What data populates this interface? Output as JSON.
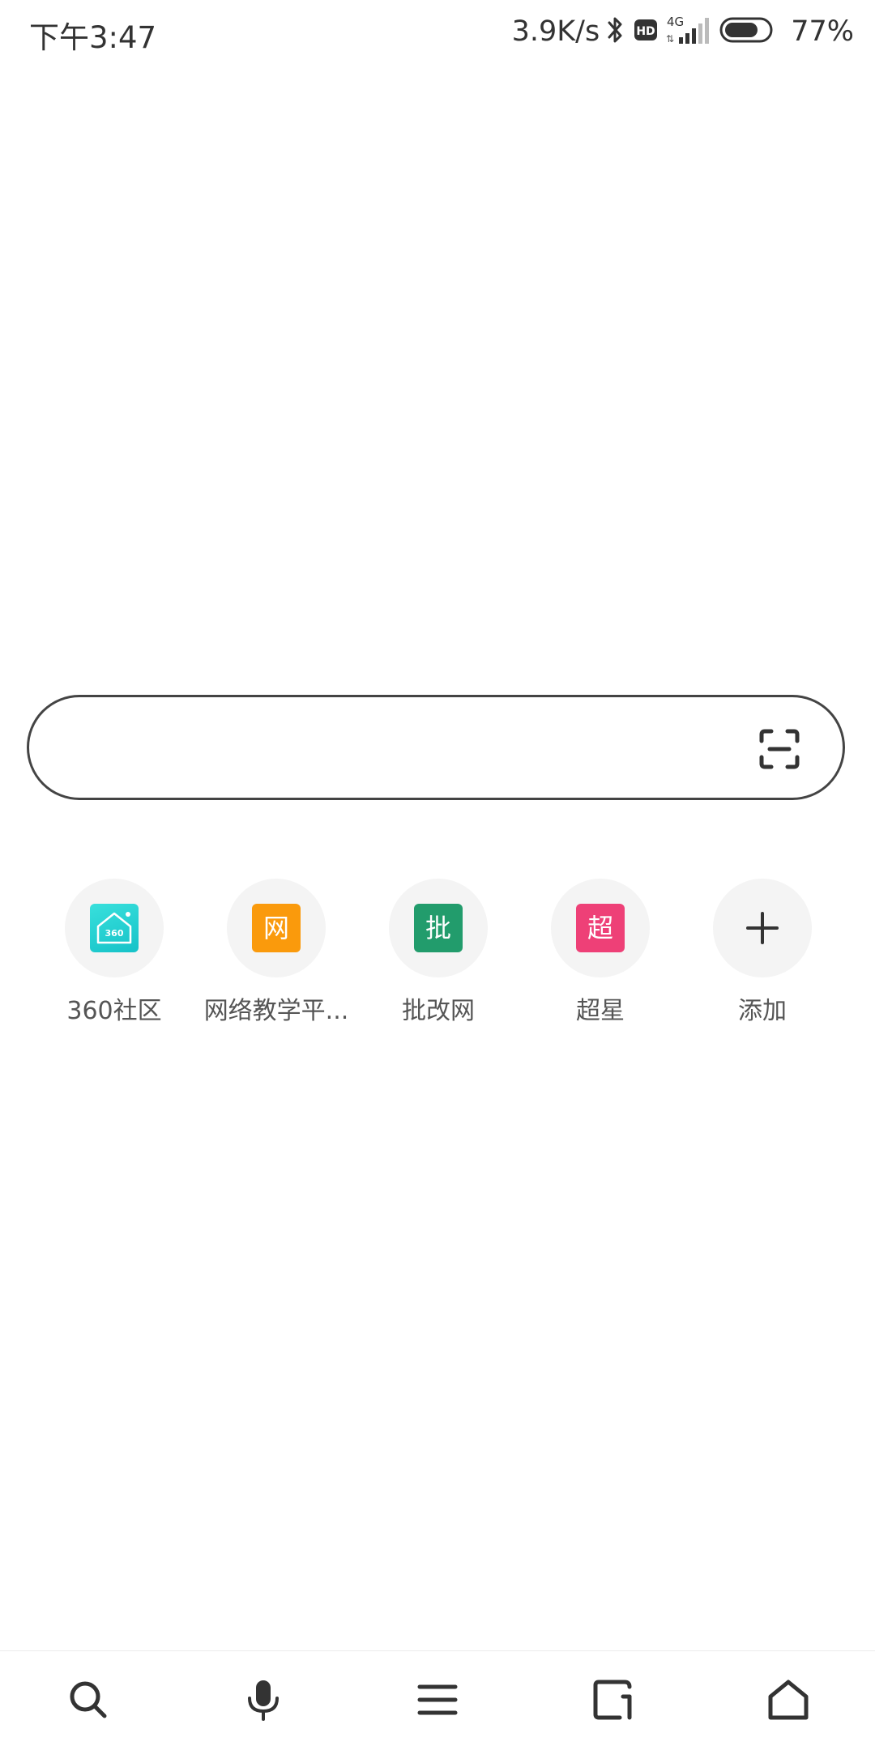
{
  "status_bar": {
    "time": "下午3:47",
    "net_speed": "3.9K/s",
    "network_type": "4G",
    "hd_badge": "HD",
    "battery_percent": "77%",
    "battery_level": 0.77,
    "icons": [
      "bluetooth-icon",
      "hd-icon",
      "signal-icon",
      "battery-icon"
    ]
  },
  "search": {
    "placeholder": "",
    "value": "",
    "scan_icon": "scan-icon"
  },
  "shortcuts": [
    {
      "label": "360社区",
      "tile_text": "360",
      "color": "#1fcfcf"
    },
    {
      "label": "网络教学平...",
      "tile_text": "网",
      "color": "#fa9a0c"
    },
    {
      "label": "批改网",
      "tile_text": "批",
      "color": "#229c6c"
    },
    {
      "label": "超星",
      "tile_text": "超",
      "color": "#ee4077"
    },
    {
      "label": "添加",
      "icon": "plus-icon"
    }
  ],
  "bottom_nav": {
    "items": [
      "search-icon",
      "microphone-icon",
      "menu-icon",
      "tabs-icon",
      "home-icon"
    ]
  }
}
